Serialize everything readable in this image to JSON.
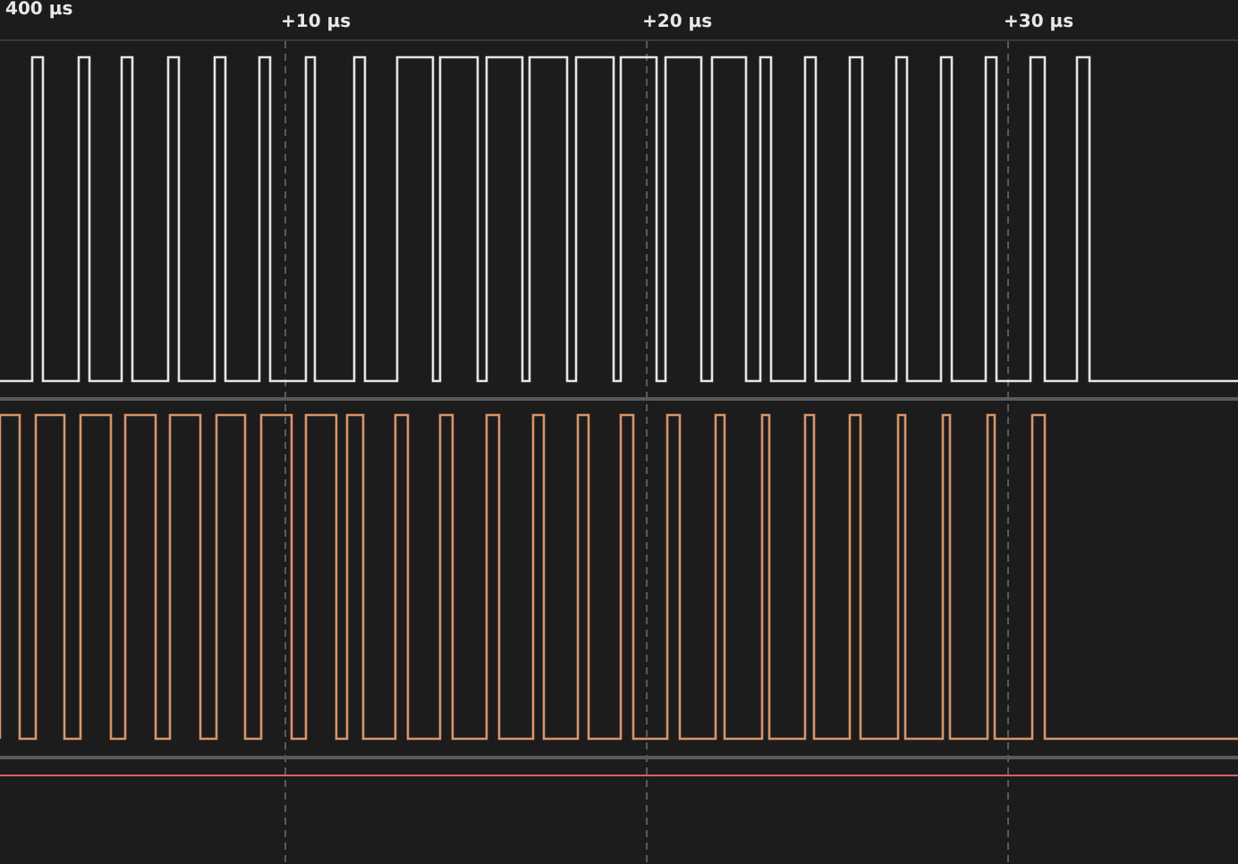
{
  "time_axis": {
    "labels": [
      {
        "text": "400 µs"
      },
      {
        "text": "+10 µs"
      },
      {
        "text": "+20 µs"
      },
      {
        "text": "+30 µs"
      }
    ]
  },
  "channels": [
    {
      "color": "#e6e6e6"
    },
    {
      "color": "#d8956a"
    }
  ]
}
